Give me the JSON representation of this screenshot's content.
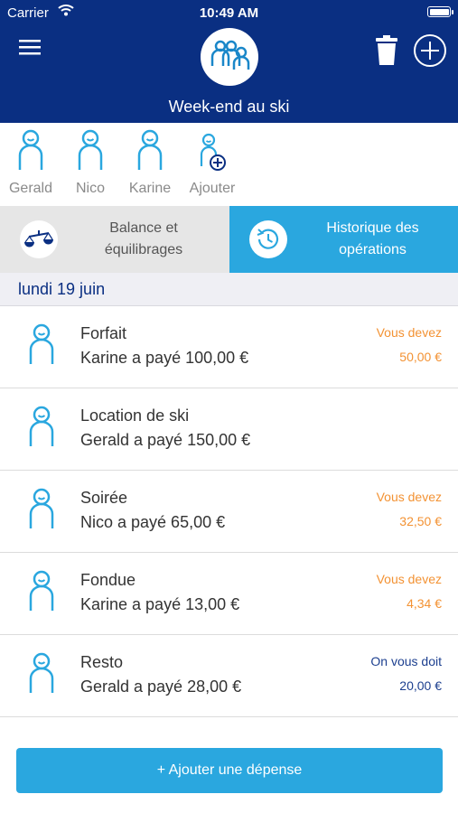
{
  "status_bar": {
    "carrier": "Carrier",
    "time": "10:49 AM",
    "battery_level": 1.0
  },
  "header": {
    "title": "Week-end au ski",
    "logo_icon": "group-people-icon"
  },
  "members": [
    {
      "name": "Gerald"
    },
    {
      "name": "Nico"
    },
    {
      "name": "Karine"
    }
  ],
  "add_member_label": "Ajouter",
  "tabs": {
    "balance": {
      "label_line1": "Balance et",
      "label_line2": "équilibrages",
      "icon": "scale-icon"
    },
    "history": {
      "label_line1": "Historique des",
      "label_line2": "opérations",
      "icon": "history-clock-icon"
    }
  },
  "date_section": "lundi 19 juin",
  "operations": [
    {
      "title": "Forfait",
      "paid": "Karine a payé 100,00 €",
      "status": "Vous devez",
      "amount": "50,00 €",
      "color": "#f39233"
    },
    {
      "title": "Location de ski",
      "paid": "Gerald a payé 150,00 €",
      "status": "",
      "amount": "",
      "color": "#f39233"
    },
    {
      "title": "Soirée",
      "paid": "Nico a payé 65,00 €",
      "status": "Vous devez",
      "amount": "32,50 €",
      "color": "#f39233"
    },
    {
      "title": "Fondue",
      "paid": "Karine a payé 13,00 €",
      "status": "Vous devez",
      "amount": "4,34 €",
      "color": "#f39233"
    },
    {
      "title": "Resto",
      "paid": "Gerald a payé 28,00 €",
      "status": "On vous doit",
      "amount": "20,00 €",
      "color": "#1c3f8f"
    }
  ],
  "add_expense_label": "+ Ajouter une dépense",
  "colors": {
    "header_bg": "#0a2f82",
    "accent": "#2aa7df",
    "owe": "#f39233",
    "owed": "#1c3f8f"
  }
}
